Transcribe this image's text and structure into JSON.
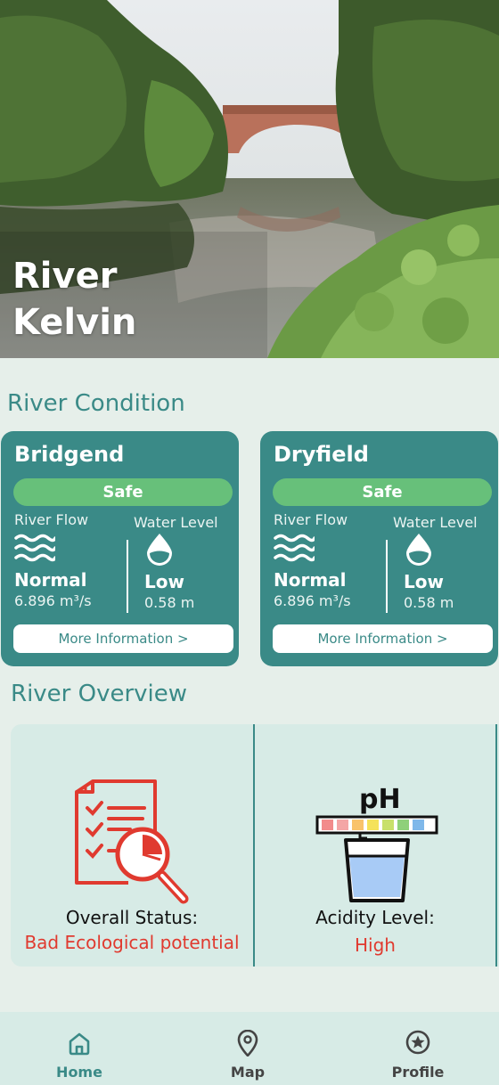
{
  "hero": {
    "title": "River Kelvin"
  },
  "sections": {
    "condition": "River Condition",
    "overview": "River Overview"
  },
  "cards": [
    {
      "name": "Bridgend",
      "status": "Safe",
      "flow_label": "River Flow",
      "flow_value": "Normal",
      "flow_rate": "6.896 m³/s",
      "level_label": "Water Level",
      "level_value": "Low",
      "level_amount": "0.58 m",
      "button": "More Information >"
    },
    {
      "name": "Dryfield",
      "status": "Safe",
      "flow_label": "River Flow",
      "flow_value": "Normal",
      "flow_rate": "6.896 m³/s",
      "level_label": "Water Level",
      "level_value": "Low",
      "level_amount": "0.58 m",
      "button": "More Information >"
    }
  ],
  "overview": {
    "status_label": "Overall Status:",
    "status_value": "Bad Ecological potential",
    "acidity_label": "Acidity Level:",
    "acidity_value": "High",
    "ph_text": "pH"
  },
  "nav": [
    {
      "label": "Home",
      "icon": "home-icon"
    },
    {
      "label": "Map",
      "icon": "map-pin-icon"
    },
    {
      "label": "Profile",
      "icon": "star-circle-icon"
    }
  ],
  "colors": {
    "teal": "#3a8a87",
    "safe": "#67c07a",
    "alert": "#e03a2f",
    "background": "#e6efea"
  }
}
